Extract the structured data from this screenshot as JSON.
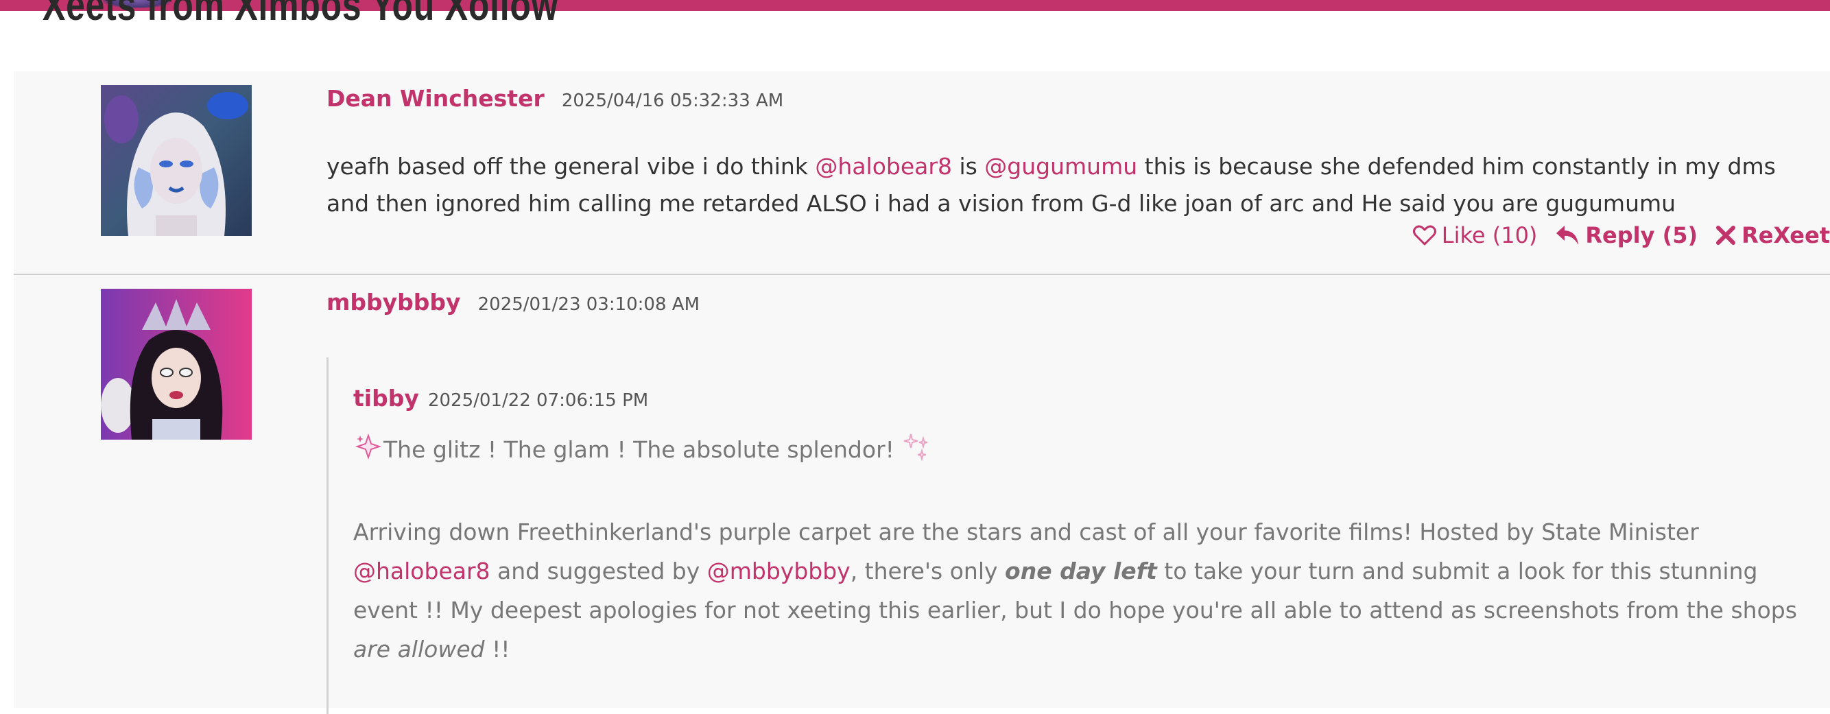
{
  "header": {
    "section_title": "Xeets from Ximbos You Xollow"
  },
  "posts": [
    {
      "author": "Dean Winchester",
      "timestamp": "2025/04/16 05:32:33 AM",
      "body": {
        "p1": "yeafh based off the general vibe i do think ",
        "m1": "@halobear8",
        "p2": " is ",
        "m2": "@gugumumu",
        "p3": " this is because she defended him constantly in my dms and then ignored him calling me retarded ALSO i had a vision from G-d like joan of arc and He said you are gugumumu"
      },
      "actions": {
        "like_label": "Like (10)",
        "reply_label": "Reply (5)",
        "rexeet_label": "ReXeet"
      }
    },
    {
      "author": "mbbybbby",
      "timestamp": "2025/01/23 03:10:08 AM",
      "quote": {
        "author": "tibby",
        "timestamp": "2025/01/22 07:06:15 PM",
        "line1": "The glitz ! The glam ! The absolute splendor!",
        "para": {
          "t1": "Arriving down Freethinkerland's purple carpet are the stars and cast of all your favorite films! Hosted by State Minister ",
          "m1": "@halobear8",
          "t2": " and suggested by ",
          "m2": "@mbbybbby",
          "t3": ", there's only ",
          "emph1": "one day left",
          "t4": " to take your turn and submit a look for this stunning event !! My deepest apologies for not xeeting this earlier, but I do hope you're all able to attend as screenshots from the shops ",
          "emph2": "are allowed",
          "t5": " !!"
        }
      }
    }
  ],
  "colors": {
    "accent": "#c2326b",
    "feed_bg": "#f8f8f8",
    "body_text": "#333333",
    "quote_text": "#777777"
  },
  "icons": {
    "like": "heart-icon",
    "reply": "reply-arrow-icon",
    "rexeet": "close-x-icon",
    "sparkle": "sparkle-icon"
  }
}
